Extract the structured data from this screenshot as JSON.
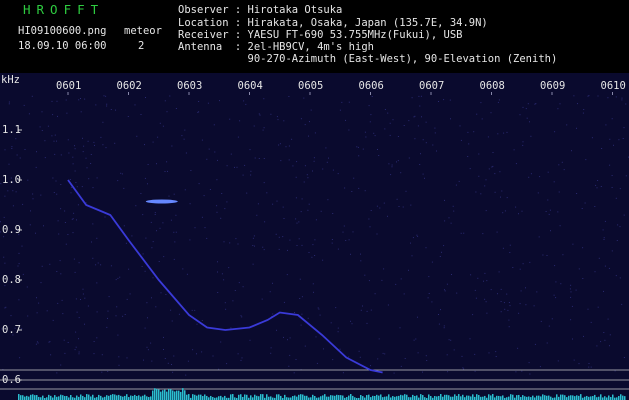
{
  "header": {
    "app_title": "HROFFT",
    "filename": "HI09100600.png",
    "timestamp": "18.09.10 06:00",
    "meteor_label": "meteor",
    "meteor_count": "2",
    "info_lines": [
      "Observer : Hirotaka Otsuka",
      "Location : Hirakata, Osaka, Japan (135.7E, 34.9N)",
      "Receiver : YAESU FT-690 53.755MHz(Fukui), USB",
      "Antenna  : 2el-HB9CV, 4m's high",
      "           90-270-Azimuth (East-West), 90-Elevation (Zenith)"
    ]
  },
  "chart_data": {
    "type": "spectrogram",
    "yunit": "kHz",
    "x_ticks": [
      "0601",
      "0602",
      "0603",
      "0604",
      "0605",
      "0606",
      "0607",
      "0608",
      "0609",
      "0610"
    ],
    "y_ticks": [
      "1.1",
      "1.0",
      "0.9",
      "0.8",
      "0.7",
      "0.6"
    ],
    "ylim": [
      0.6,
      1.15
    ],
    "trace": [
      [
        0.0,
        1.0
      ],
      [
        0.3,
        0.95
      ],
      [
        0.5,
        0.94
      ],
      [
        0.7,
        0.93
      ],
      [
        1.0,
        0.88
      ],
      [
        1.5,
        0.8
      ],
      [
        2.0,
        0.73
      ],
      [
        2.3,
        0.705
      ],
      [
        2.6,
        0.7
      ],
      [
        3.0,
        0.705
      ],
      [
        3.3,
        0.72
      ],
      [
        3.5,
        0.735
      ],
      [
        3.8,
        0.73
      ],
      [
        4.2,
        0.69
      ],
      [
        4.6,
        0.645
      ],
      [
        5.0,
        0.62
      ],
      [
        5.2,
        0.615
      ]
    ],
    "meteors": [
      {
        "x": 1.55,
        "y": 0.957
      }
    ],
    "colors": {
      "background": "#0a0a2e",
      "trace": "#3a3ad8",
      "meteor": "#6688ff",
      "grid": "#c8c8c8"
    }
  }
}
